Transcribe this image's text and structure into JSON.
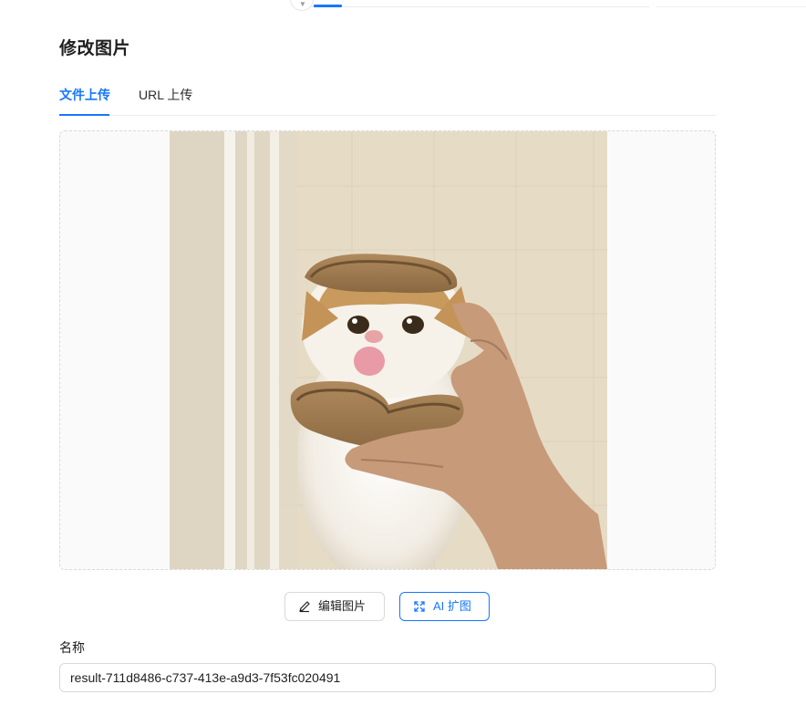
{
  "page": {
    "title": "修改图片"
  },
  "tabs": [
    {
      "label": "文件上传",
      "active": true
    },
    {
      "label": "URL 上传",
      "active": false
    }
  ],
  "buttons": {
    "edit_image": {
      "label": "编辑图片",
      "icon": "pencil-icon"
    },
    "ai_expand": {
      "label": "AI 扩图",
      "icon": "expand-icon"
    }
  },
  "name_field": {
    "label": "名称",
    "value": "result-711d8486-c737-413e-a9d3-7f53fc020491"
  },
  "colors": {
    "accent": "#1677ff",
    "border": "#d9d9d9"
  }
}
